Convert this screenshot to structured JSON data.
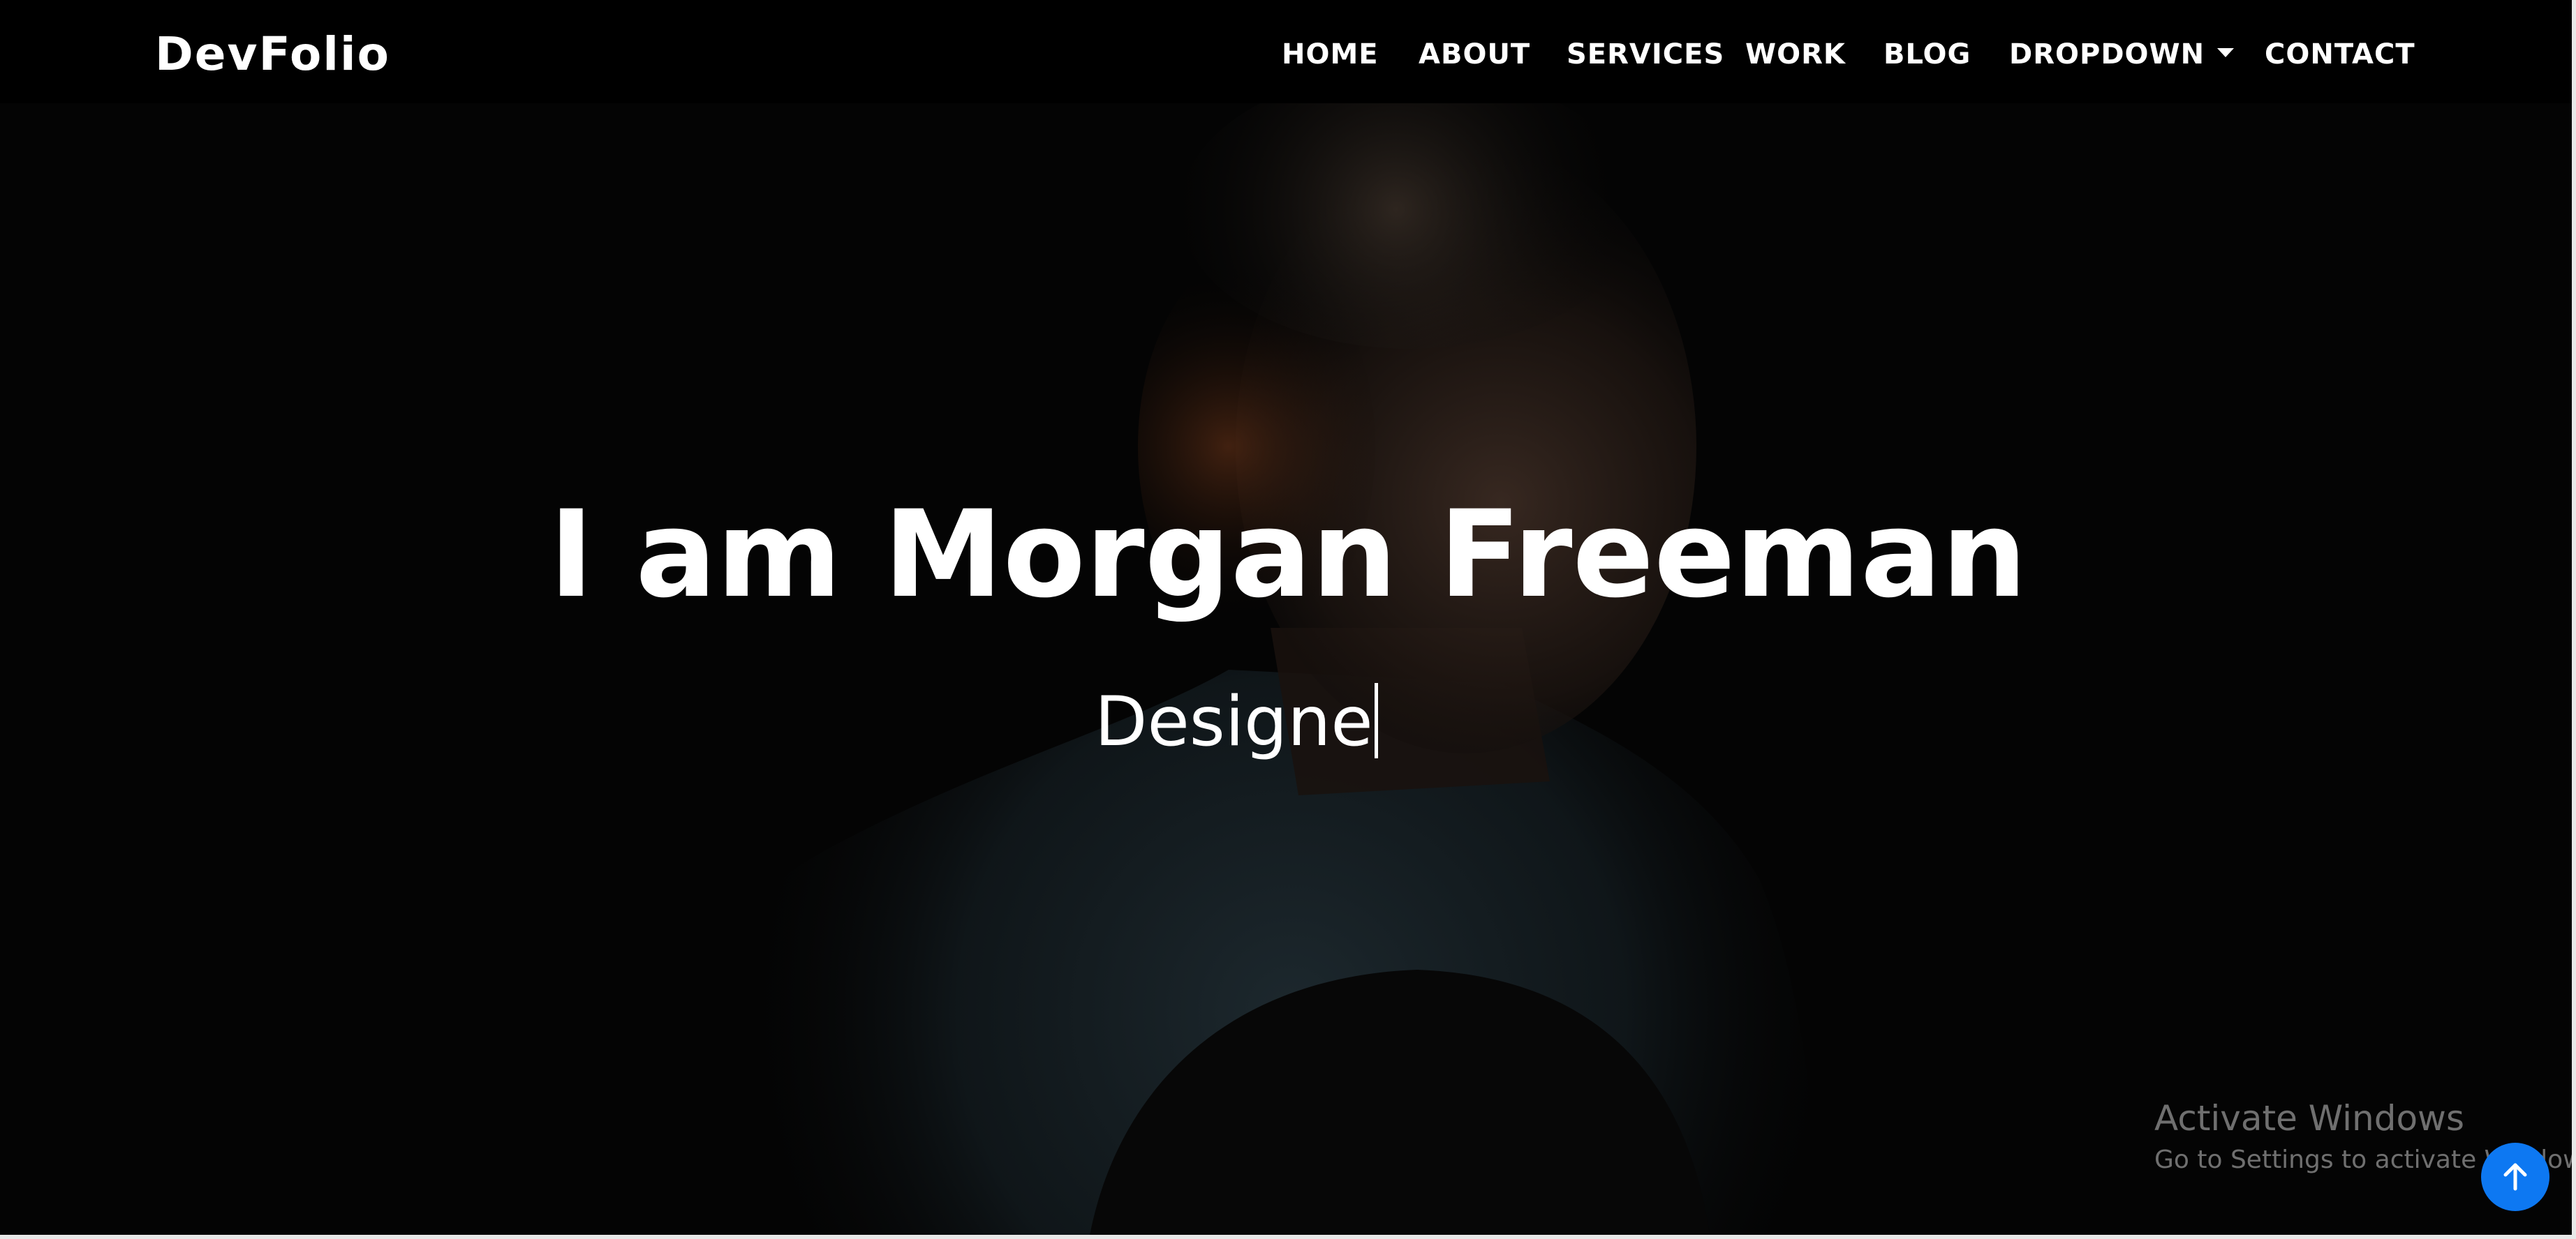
{
  "navbar": {
    "brand": "DevFolio",
    "items": [
      {
        "label": "HOME"
      },
      {
        "label": "ABOUT"
      },
      {
        "label": "SERVICES"
      },
      {
        "label": "WORK"
      },
      {
        "label": "BLOG"
      },
      {
        "label": "DROPDOWN"
      },
      {
        "label": "CONTACT"
      }
    ]
  },
  "hero": {
    "title": "I am Morgan Freeman",
    "subtitle": "Designe"
  },
  "watermark": {
    "title": "Activate Windows",
    "subtitle": "Go to Settings to activate Windows."
  },
  "icons": {
    "back_to_top": "arrow-up-icon",
    "dropdown": "caret-down-icon"
  },
  "colors": {
    "navbar_bg": "#000000",
    "accent": "#0d78f2",
    "text": "#ffffff"
  }
}
